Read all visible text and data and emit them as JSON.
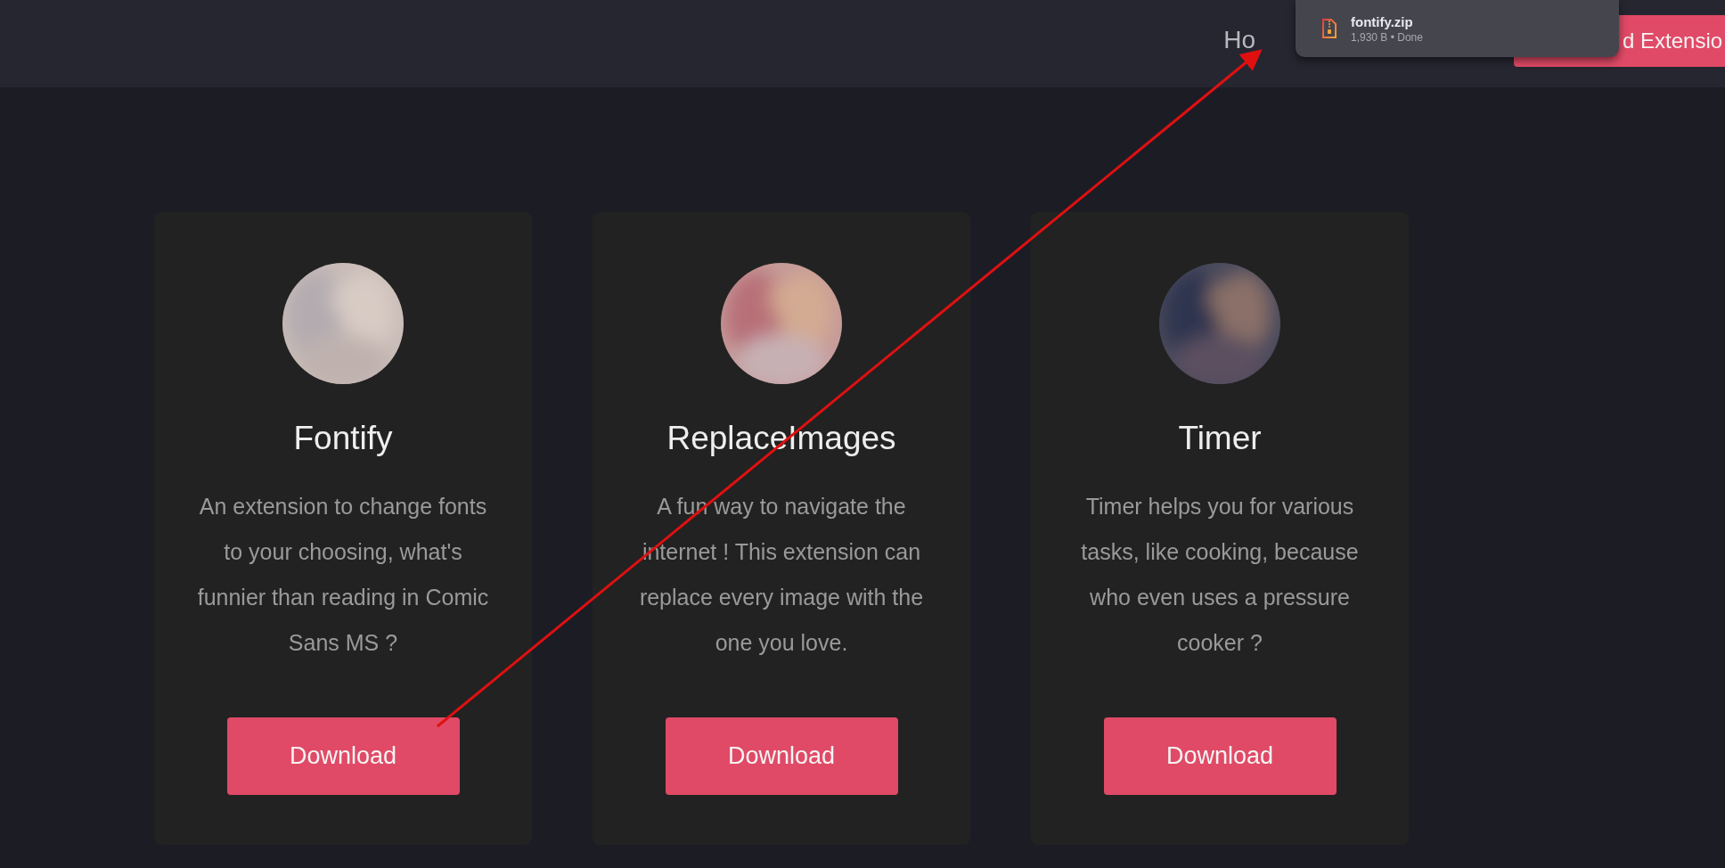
{
  "header": {
    "nav_link": "Ho",
    "cta_button": "d Extensio"
  },
  "download_popup": {
    "filename": "fontify.zip",
    "status": "1,930 B • Done"
  },
  "cards": [
    {
      "title": "Fontify",
      "description": "An extension to change fonts to your choosing, what's funnier than reading in Comic Sans MS ?",
      "button": "Download"
    },
    {
      "title": "ReplaceImages",
      "description": "A fun way to navigate the internet ! This extension can replace every image with the one you love.",
      "button": "Download"
    },
    {
      "title": "Timer",
      "description": "Timer helps you for various tasks, like cooking, because who even uses a pressure cooker ?",
      "button": "Download"
    }
  ]
}
